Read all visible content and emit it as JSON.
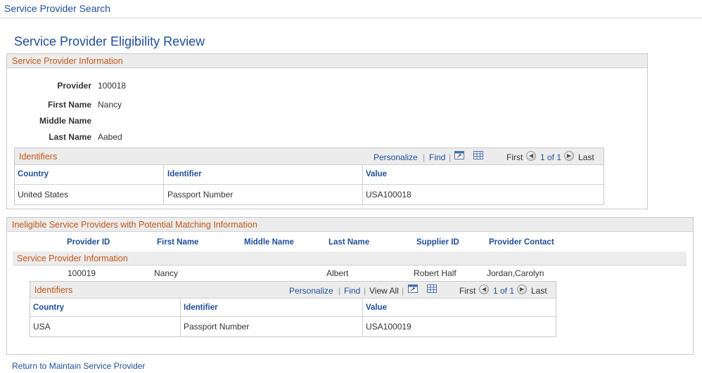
{
  "header": {
    "breadcrumb": "Service Provider Search"
  },
  "page": {
    "title": "Service Provider Eligibility Review"
  },
  "provider_info": {
    "section_title": "Service Provider Information",
    "fields": [
      {
        "label": "Provider",
        "value": "100018"
      },
      {
        "label": "First Name",
        "value": "Nancy"
      },
      {
        "label": "Middle Name",
        "value": ""
      },
      {
        "label": "Last Name",
        "value": "Aabed"
      }
    ],
    "identifiers": {
      "title": "Identifiers",
      "personalize": "Personalize",
      "find": "Find",
      "first": "First",
      "range": "1 of 1",
      "last": "Last",
      "columns": [
        "Country",
        "Identifier",
        "Value"
      ],
      "rows": [
        [
          "United States",
          "Passport Number",
          "USA100018"
        ]
      ]
    }
  },
  "ineligible": {
    "section_title": "Ineligible Service Providers with Potential Matching Information",
    "columns": [
      "Provider ID",
      "First Name",
      "Middle Name",
      "Last Name",
      "Supplier ID",
      "Provider Contact"
    ],
    "sub_title": "Service Provider Information",
    "row": {
      "provider_id": "100019",
      "first_name": "Nancy",
      "middle_name": "",
      "last_name": "Albert",
      "supplier_id": "Robert Half",
      "provider_contact": "Jordan,Carolyn"
    },
    "identifiers": {
      "title": "Identifiers",
      "personalize": "Personalize",
      "find": "Find",
      "view_all": "View All",
      "first": "First",
      "range": "1 of 1",
      "last": "Last",
      "columns": [
        "Country",
        "Identifier",
        "Value"
      ],
      "rows": [
        [
          "USA",
          "Passport Number",
          "USA100019"
        ]
      ]
    }
  },
  "footer": {
    "return_link": "Return to Maintain Service Provider"
  },
  "icons": {
    "zoom": "zoom-grid-icon",
    "download": "download-spreadsheet-icon",
    "prev": "previous-arrow-icon",
    "next": "next-arrow-icon"
  }
}
